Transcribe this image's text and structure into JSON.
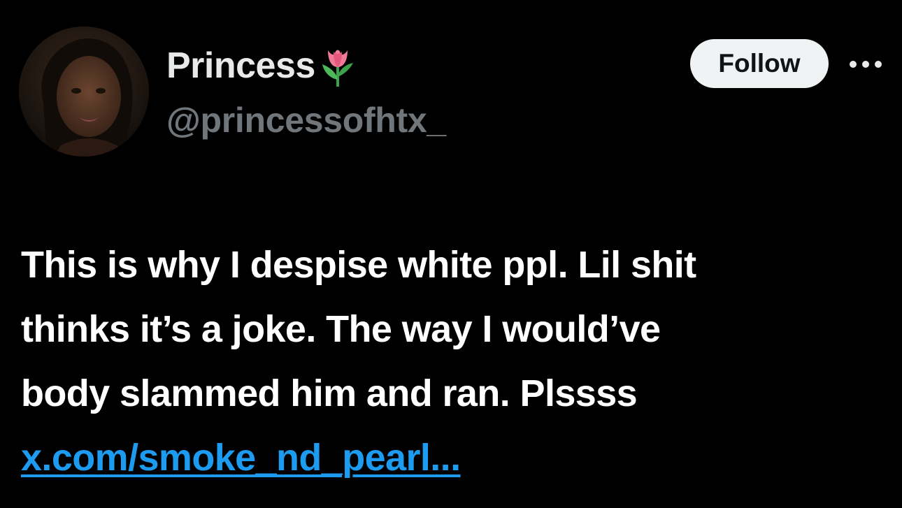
{
  "author": {
    "display_name": "Princess",
    "name_emoji_icon": "tulip-icon",
    "handle": "@princessofhtx_",
    "avatar_icon": "profile-photo"
  },
  "actions": {
    "follow_label": "Follow",
    "more_icon": "more-options-icon"
  },
  "tweet": {
    "lines": [
      "This is why I despise white ppl. Lil shit",
      "thinks it’s a joke. The way I would’ve",
      "body slammed him and ran. Plssss"
    ],
    "link_text": "x.com/smoke_nd_pearl..."
  },
  "colors": {
    "background": "#000000",
    "text_primary": "#ffffff",
    "text_secondary": "#71767b",
    "link": "#1d9bf0",
    "button_bg": "#eff3f4",
    "button_text": "#0f1419"
  }
}
